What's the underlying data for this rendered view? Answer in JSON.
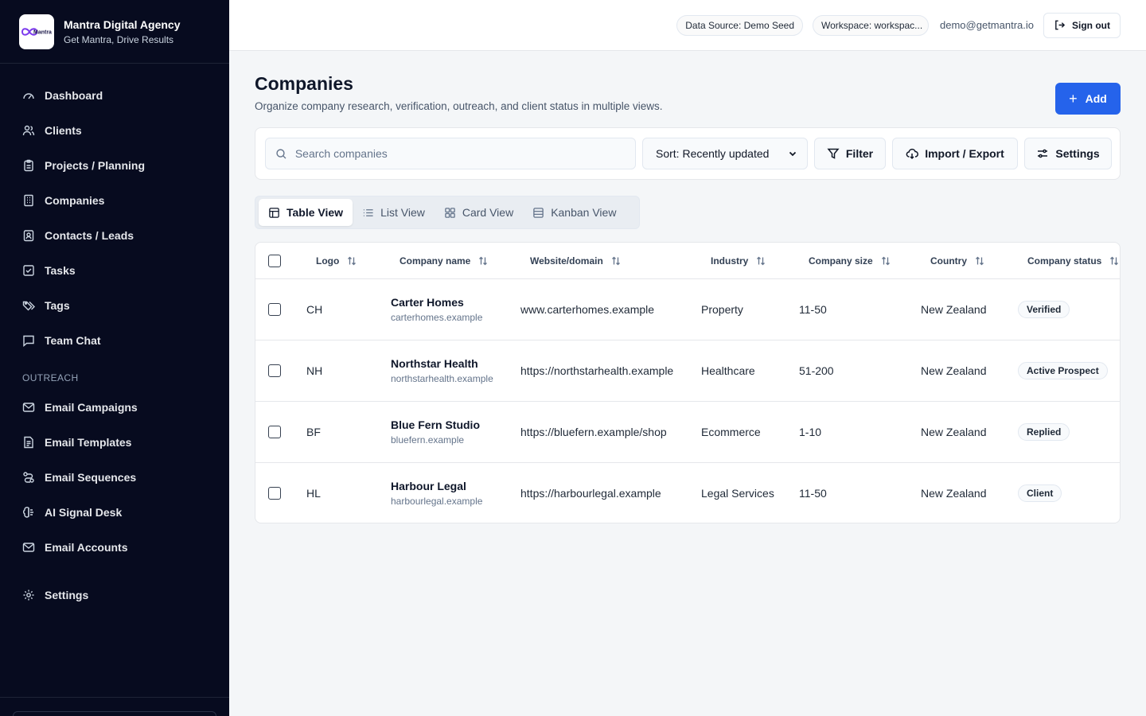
{
  "brand": {
    "logo_text": "Mantra",
    "name": "Mantra Digital Agency",
    "tagline": "Get Mantra, Drive Results"
  },
  "nav": {
    "items": [
      {
        "label": "Dashboard",
        "icon": "gauge-icon"
      },
      {
        "label": "Clients",
        "icon": "users-icon"
      },
      {
        "label": "Projects / Planning",
        "icon": "clipboard-icon"
      },
      {
        "label": "Companies",
        "icon": "building-icon"
      },
      {
        "label": "Contacts / Leads",
        "icon": "contact-icon"
      },
      {
        "label": "Tasks",
        "icon": "check-square-icon"
      },
      {
        "label": "Tags",
        "icon": "tags-icon"
      },
      {
        "label": "Team Chat",
        "icon": "chat-icon"
      }
    ],
    "outreach_label": "OUTREACH",
    "outreach_items": [
      {
        "label": "Email Campaigns",
        "icon": "mail-icon"
      },
      {
        "label": "Email Templates",
        "icon": "file-text-icon"
      },
      {
        "label": "Email Sequences",
        "icon": "route-icon"
      },
      {
        "label": "AI Signal Desk",
        "icon": "brain-icon"
      },
      {
        "label": "Email Accounts",
        "icon": "mail-icon"
      }
    ],
    "settings_label": "Settings"
  },
  "topbar": {
    "data_source": "Data Source: Demo Seed",
    "workspace": "Workspace: workspac...",
    "email": "demo@getmantra.io",
    "sign_out": "Sign out"
  },
  "page": {
    "title": "Companies",
    "subtitle": "Organize company research, verification, outreach, and client status in multiple views.",
    "add_label": "Add"
  },
  "toolbar": {
    "search_placeholder": "Search companies",
    "sort_value": "Sort: Recently updated",
    "filter_label": "Filter",
    "import_export_label": "Import / Export",
    "settings_label": "Settings"
  },
  "views": {
    "table": "Table View",
    "list": "List View",
    "card": "Card View",
    "kanban": "Kanban View",
    "active": "table"
  },
  "table": {
    "columns": [
      "Logo",
      "Company name",
      "Website/domain",
      "Industry",
      "Company size",
      "Country",
      "Company status"
    ],
    "rows": [
      {
        "logo": "CH",
        "name": "Carter Homes",
        "domain": "carterhomes.example",
        "website": "www.carterhomes.example",
        "industry": "Property",
        "size": "11-50",
        "country": "New Zealand",
        "status": "Verified"
      },
      {
        "logo": "NH",
        "name": "Northstar Health",
        "domain": "northstarhealth.example",
        "website": "https://northstarhealth.example",
        "industry": "Healthcare",
        "size": "51-200",
        "country": "New Zealand",
        "status": "Active Prospect"
      },
      {
        "logo": "BF",
        "name": "Blue Fern Studio",
        "domain": "bluefern.example",
        "website": "https://bluefern.example/shop",
        "industry": "Ecommerce",
        "size": "1-10",
        "country": "New Zealand",
        "status": "Replied"
      },
      {
        "logo": "HL",
        "name": "Harbour Legal",
        "domain": "harbourlegal.example",
        "website": "https://harbourlegal.example",
        "industry": "Legal Services",
        "size": "11-50",
        "country": "New Zealand",
        "status": "Client"
      }
    ]
  },
  "colors": {
    "sidebar_bg": "#070b1f",
    "accent": "#2563eb",
    "page_bg": "#f4f6f8"
  }
}
